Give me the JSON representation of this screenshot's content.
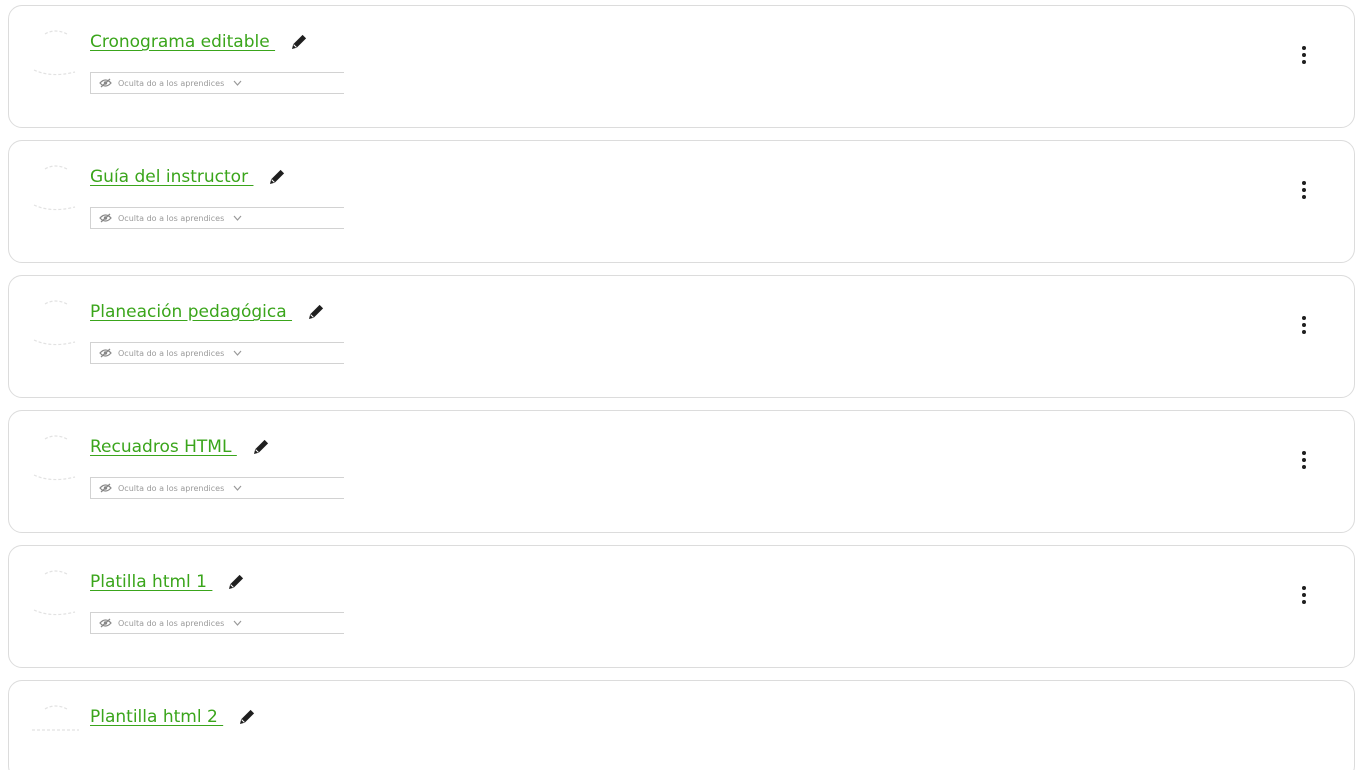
{
  "activities": [
    {
      "title": "Cronograma editable ",
      "visibility": "Oculta do a los aprendices",
      "menu": true
    },
    {
      "title": "Guía del instructor ",
      "visibility": "Oculta do a los aprendices",
      "menu": true
    },
    {
      "title": "Planeación pedagógica ",
      "visibility": "Oculta do a los aprendices",
      "menu": true
    },
    {
      "title": "Recuadros HTML ",
      "visibility": "Oculta do a los aprendices",
      "menu": true
    },
    {
      "title": "Platilla html 1 ",
      "visibility": "Oculta do a los aprendices",
      "menu": true
    },
    {
      "title": "Plantilla html 2 ",
      "visibility": "",
      "menu": false
    }
  ],
  "icons": {
    "edit": "pencil-icon",
    "visibility": "eye-slash-icon",
    "dropdown": "chevron-down-icon",
    "more": "kebab-menu-icon",
    "thumbnail": "activity-icon-placeholder"
  },
  "colors": {
    "link": "#3aa51b",
    "border": "#dcdcdc",
    "muted_text": "#9a9a9a",
    "menu_dots": "#1f1f1f"
  }
}
